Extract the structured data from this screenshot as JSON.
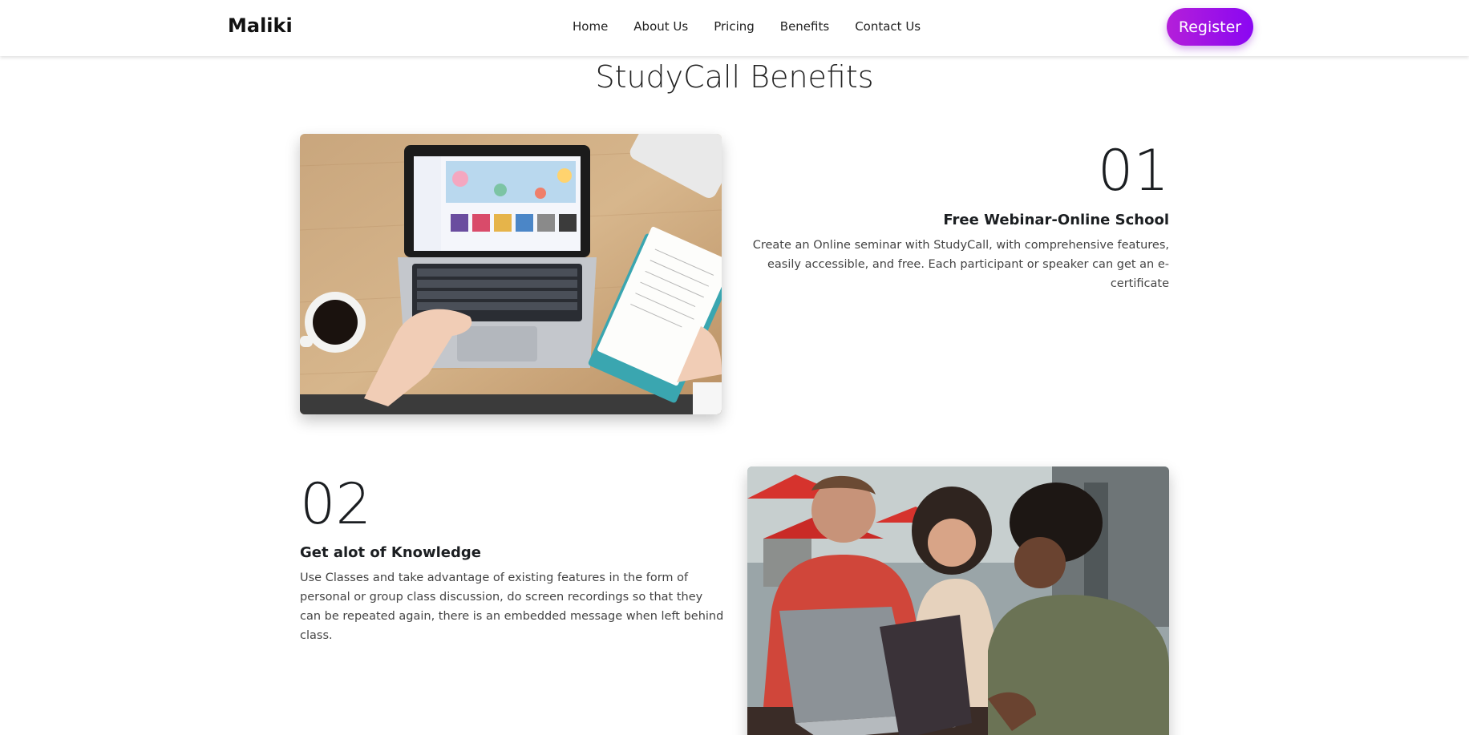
{
  "header": {
    "brand": "Maliki",
    "nav": [
      "Home",
      "About Us",
      "Pricing",
      "Benefits",
      "Contact Us"
    ],
    "register_label": "Register"
  },
  "benefits": {
    "title": "StudyCall Benefits",
    "items": [
      {
        "number": "01",
        "title": "Free Webinar-Online School",
        "description": "Create an Online seminar with StudyCall, with comprehensive features, easily accessible, and free. Each participant or speaker can get an e-certificate"
      },
      {
        "number": "02",
        "title": "Get alot of Knowledge",
        "description": "Use Classes and take advantage of existing features in the form of personal or group class discussion, do screen recordings so that they can be repeated again, there is an embedded message when left behind class."
      }
    ]
  },
  "colors": {
    "accent_start": "#b41fd9",
    "accent_end": "#8a07f2"
  }
}
